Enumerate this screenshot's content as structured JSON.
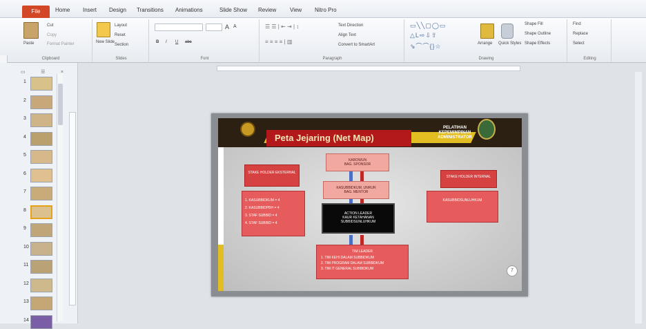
{
  "tabs": [
    "Home",
    "Insert",
    "Design",
    "Transitions",
    "Animations",
    "Slide Show",
    "Review",
    "View",
    "Nitro Pro"
  ],
  "file_tab": "File",
  "clipboard": {
    "paste": "Paste",
    "cut": "Cut",
    "copy": "Copy",
    "format_painter": "Format Painter",
    "label": "Clipboard"
  },
  "slides_group": {
    "new_slide": "New Slide",
    "layout": "Layout",
    "reset": "Reset",
    "section": "Section",
    "label": "Slides"
  },
  "font_group": {
    "label": "Font",
    "bold": "B",
    "italic": "I",
    "underline": "U",
    "strike": "abc",
    "font_grow": "A",
    "font_shrink": "A"
  },
  "paragraph_group": {
    "label": "Paragraph",
    "text_direction": "Text Direction",
    "align_text": "Align Text",
    "convert_smartart": "Convert to SmartArt"
  },
  "drawing_group": {
    "label": "Drawing",
    "arrange": "Arrange",
    "quick_styles": "Quick Styles",
    "shape_fill": "Shape Fill",
    "shape_outline": "Shape Outline",
    "shape_effects": "Shape Effects"
  },
  "editing_group": {
    "label": "Editing",
    "find": "Find",
    "replace": "Replace",
    "select": "Select"
  },
  "thumbnails": [
    "1",
    "2",
    "3",
    "4",
    "5",
    "6",
    "7",
    "8",
    "9",
    "10",
    "11",
    "12",
    "13",
    "14"
  ],
  "selected_thumbnail": 8,
  "slide": {
    "title": "Peta Jejaring (Net Map)",
    "header_right": "PELATIHAN KEPEMIMPINAN ADMINISTRATOR",
    "top_box": "KAROWUN\nBAG. SPONSOR",
    "middle_box": "KASUBBIDKUM, UNRUR\nBAG. MENTOR",
    "leader_box": "ACTION LEADER\nKAUR KETAHANAN\nSUBBIDSUNLUHKUM",
    "external_label": "STAKE HOLDER EKSTERNAL",
    "external_list": [
      "1. KASUBBIDKUM = 4",
      "2. KASUBBIDPBH = 4",
      "3. STAF SUBBID = 4",
      "4. STAF SUBBID = 4"
    ],
    "internal_label": "STAKE HOLDER INTERNAL",
    "internal_text": "KASUBBIDSUNLUHKUM",
    "bottom_title": "TIM LEADER",
    "bottom_list": [
      "1. TIM KEHI DALAM SUBBIDKUM",
      "2. TIM PROGRAM DALAM SUBBIDKUM",
      "3. TIM IT GENERAL SUBBIDKUM"
    ],
    "page_number": "7"
  }
}
